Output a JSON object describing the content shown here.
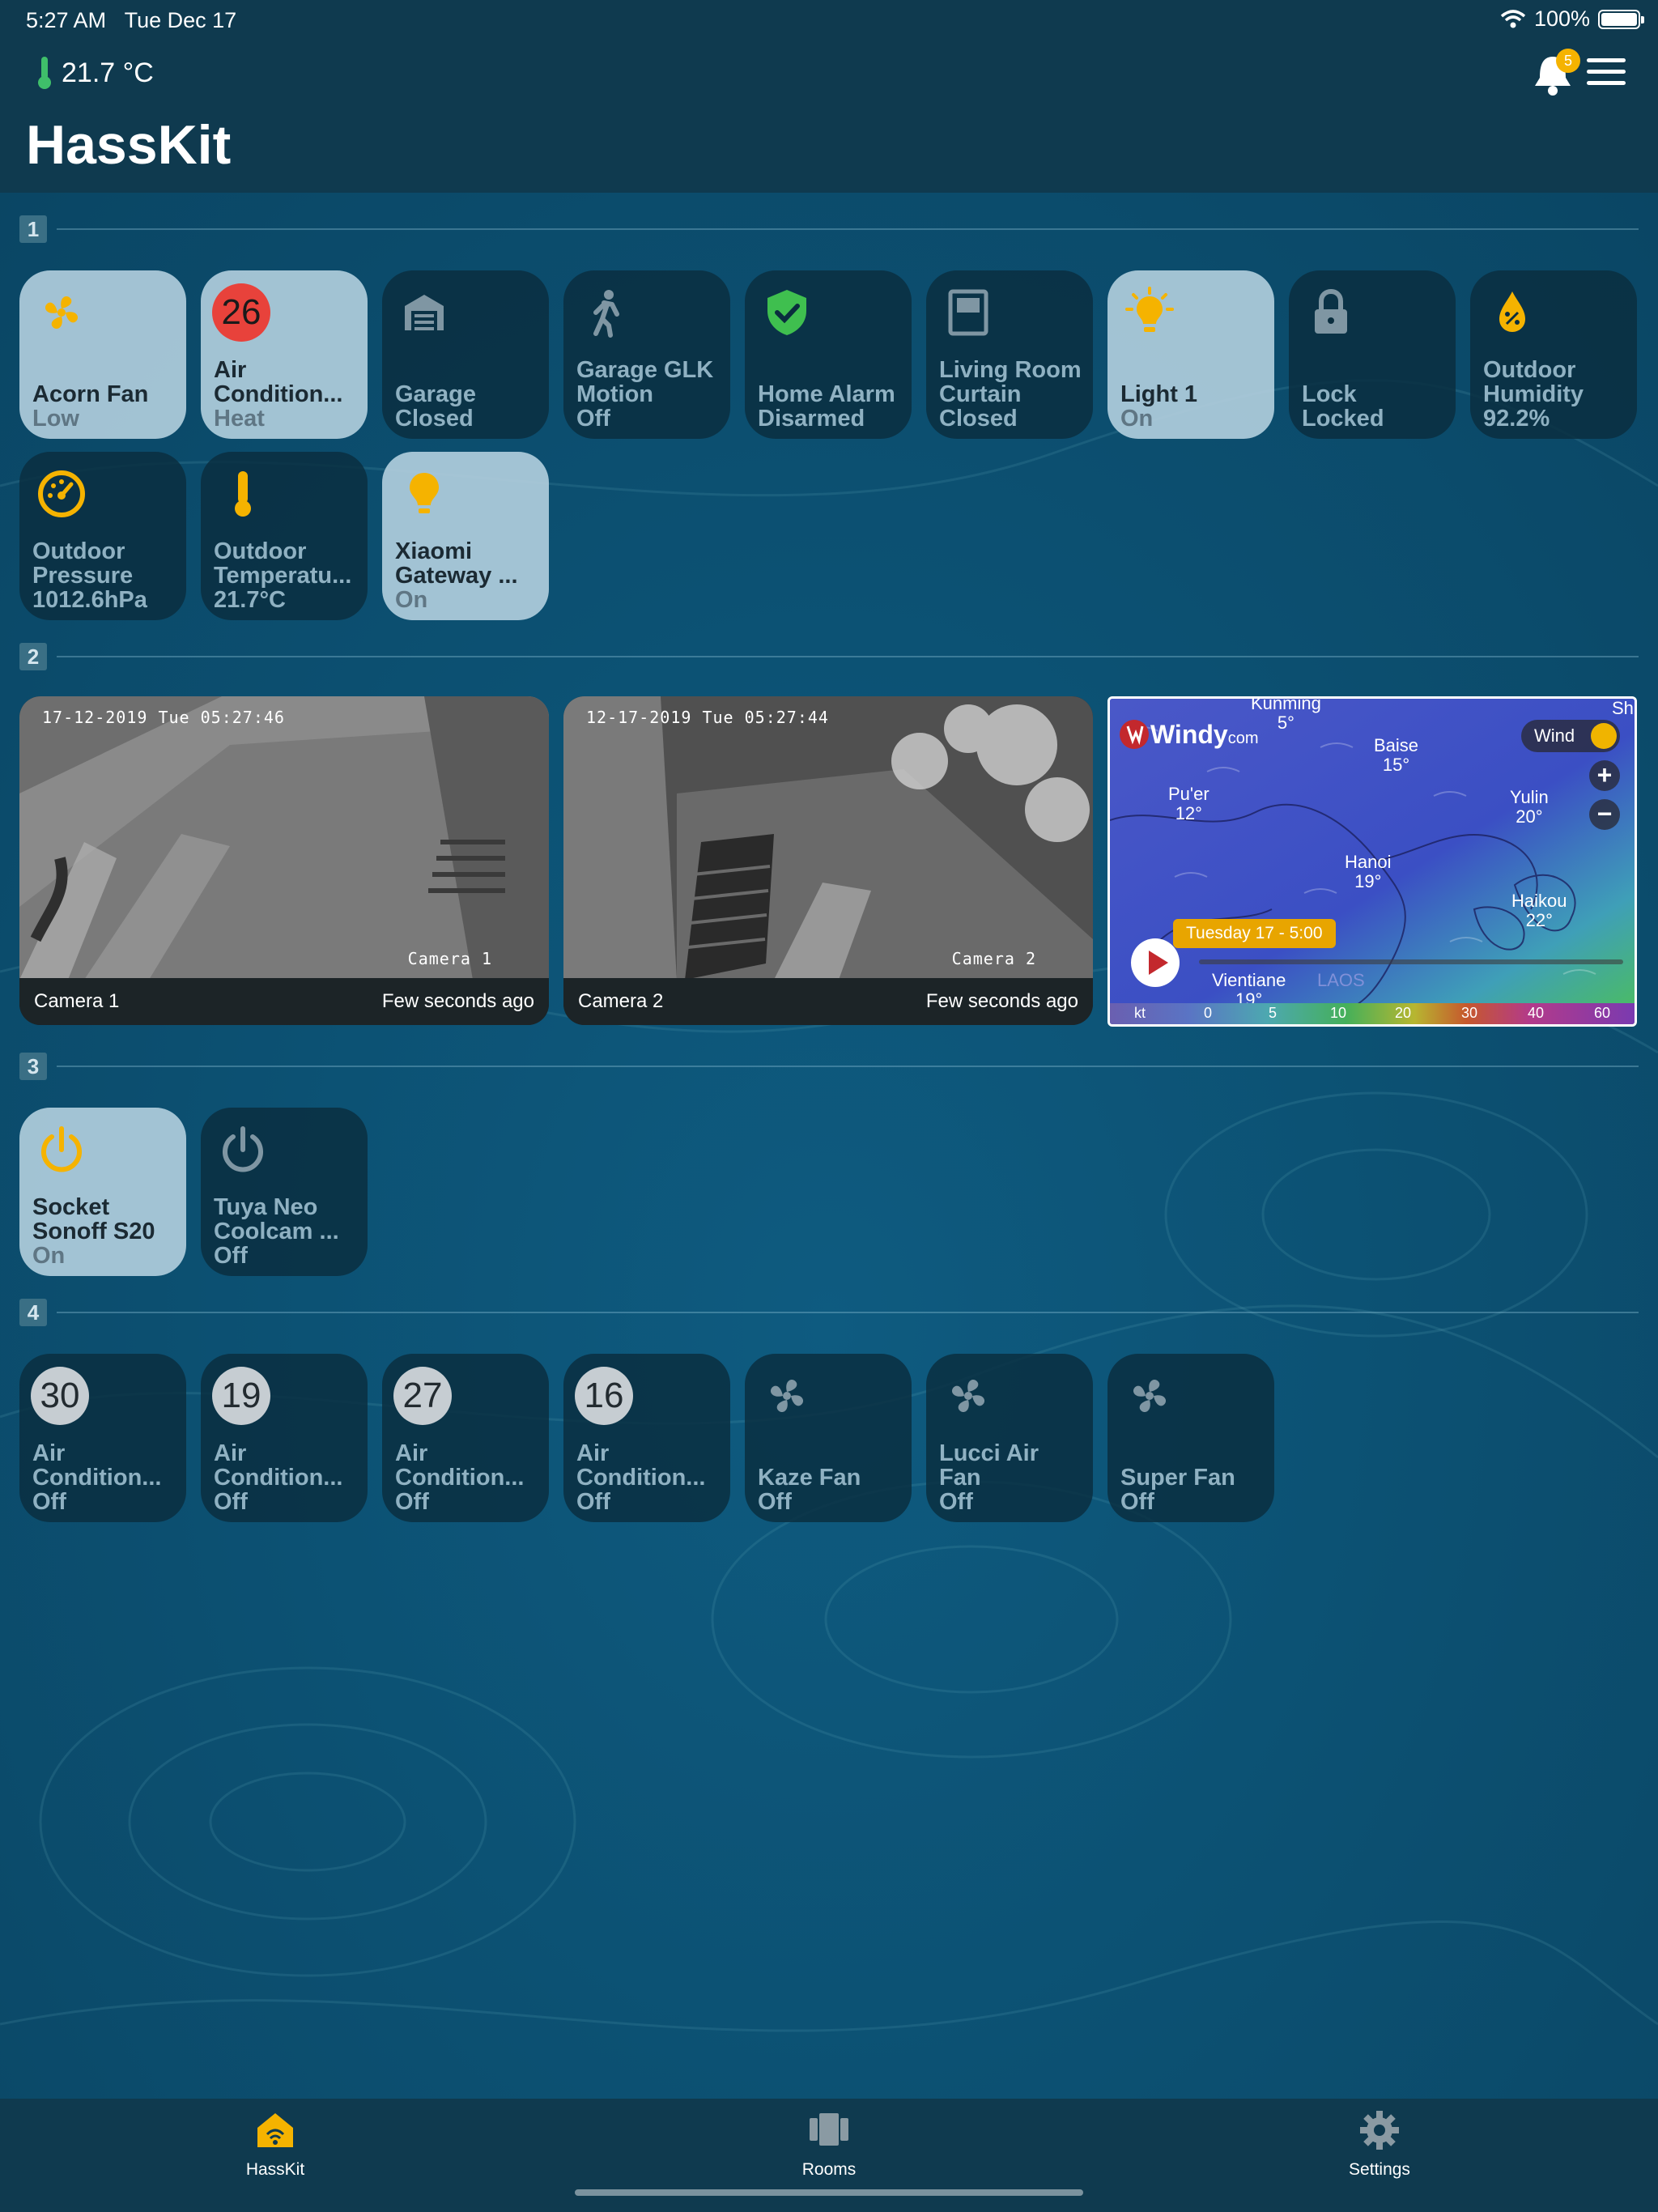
{
  "status_bar": {
    "time": "5:27 AM",
    "date": "Tue Dec 17",
    "battery": "100%"
  },
  "header": {
    "temperature": "21.7 °C",
    "title": "HassKit",
    "notification_count": "5"
  },
  "sections": [
    {
      "number": "1",
      "tiles": [
        {
          "name": "Acorn Fan",
          "state": "Low",
          "icon": "fan-icon",
          "on": true
        },
        {
          "name": "Air\nCondition...",
          "state": "Heat",
          "badge": "26",
          "on": true
        },
        {
          "name": "Garage",
          "state": "Closed",
          "icon": "garage-icon",
          "on": false
        },
        {
          "name": "Garage GLK\nMotion",
          "state": "Off",
          "icon": "walk-icon",
          "on": false
        },
        {
          "name": "Home Alarm",
          "state": "Disarmed",
          "icon": "shield-check-icon",
          "on": false
        },
        {
          "name": "Living Room\nCurtain",
          "state": "Closed",
          "icon": "curtain-icon",
          "on": false
        },
        {
          "name": "Light 1",
          "state": "On",
          "icon": "bulb-icon",
          "on": true
        },
        {
          "name": "Lock",
          "state": "Locked",
          "icon": "lock-icon",
          "on": false
        },
        {
          "name": "Outdoor\nHumidity",
          "state": "92.2%",
          "icon": "humidity-icon",
          "on": false
        },
        {
          "name": "Outdoor\nPressure",
          "state": "1012.6hPa",
          "icon": "gauge-icon",
          "on": false
        },
        {
          "name": "Outdoor\nTemperatu...",
          "state": "21.7°C",
          "icon": "thermometer-icon",
          "on": false
        },
        {
          "name": "Xiaomi\nGateway ...",
          "state": "On",
          "icon": "bulb-icon",
          "on": true
        }
      ]
    },
    {
      "number": "2",
      "cameras": [
        {
          "name": "Camera 1",
          "updated": "Few seconds ago",
          "stamp": "17-12-2019 Tue 05:27:46",
          "overlay": "Camera 1"
        },
        {
          "name": "Camera 2",
          "updated": "Few seconds ago",
          "stamp": "12-17-2019 Tue 05:27:44",
          "overlay": "Camera 2"
        }
      ],
      "map": {
        "logo": "Windy",
        "logo_suffix": "com",
        "layer_button": "Wind",
        "time_label": "Tuesday 17 - 5:00",
        "places": [
          {
            "name": "Kunming",
            "temp": "5°"
          },
          {
            "name": "Baise",
            "temp": "15°"
          },
          {
            "name": "Pu'er",
            "temp": "12°"
          },
          {
            "name": "Yulin",
            "temp": "20°"
          },
          {
            "name": "Hanoi",
            "temp": "19°"
          },
          {
            "name": "Haikou",
            "temp": "22°"
          },
          {
            "name": "Vientiane",
            "temp": "19°"
          },
          {
            "name": "LAOS",
            "temp": ""
          },
          {
            "name": "Sh",
            "temp": ""
          }
        ],
        "scale_unit": "kt",
        "scale_ticks": [
          "0",
          "5",
          "10",
          "20",
          "30",
          "40",
          "60"
        ]
      }
    },
    {
      "number": "3",
      "tiles": [
        {
          "name": "Socket\nSonoff S20",
          "state": "On",
          "icon": "power-icon",
          "on": true
        },
        {
          "name": "Tuya Neo\nCoolcam ...",
          "state": "Off",
          "icon": "power-icon",
          "on": false
        }
      ]
    },
    {
      "number": "4",
      "tiles": [
        {
          "name": "Air\nCondition...",
          "state": "Off",
          "badge": "30",
          "on": false
        },
        {
          "name": "Air\nCondition...",
          "state": "Off",
          "badge": "19",
          "on": false
        },
        {
          "name": "Air\nCondition...",
          "state": "Off",
          "badge": "27",
          "on": false
        },
        {
          "name": "Air\nCondition...",
          "state": "Off",
          "badge": "16",
          "on": false
        },
        {
          "name": "Kaze Fan",
          "state": "Off",
          "icon": "fan-icon",
          "on": false
        },
        {
          "name": "Lucci Air\nFan",
          "state": "Off",
          "icon": "fan-icon",
          "on": false
        },
        {
          "name": "Super Fan",
          "state": "Off",
          "icon": "fan-icon",
          "on": false
        }
      ]
    }
  ],
  "tabbar": {
    "tabs": [
      "HassKit",
      "Rooms",
      "Settings"
    ]
  },
  "colors": {
    "accent": "#F5B300",
    "tile_on": "#B0CDDC",
    "tile_off": "#0A2D3E",
    "header": "#0F3A4F"
  }
}
